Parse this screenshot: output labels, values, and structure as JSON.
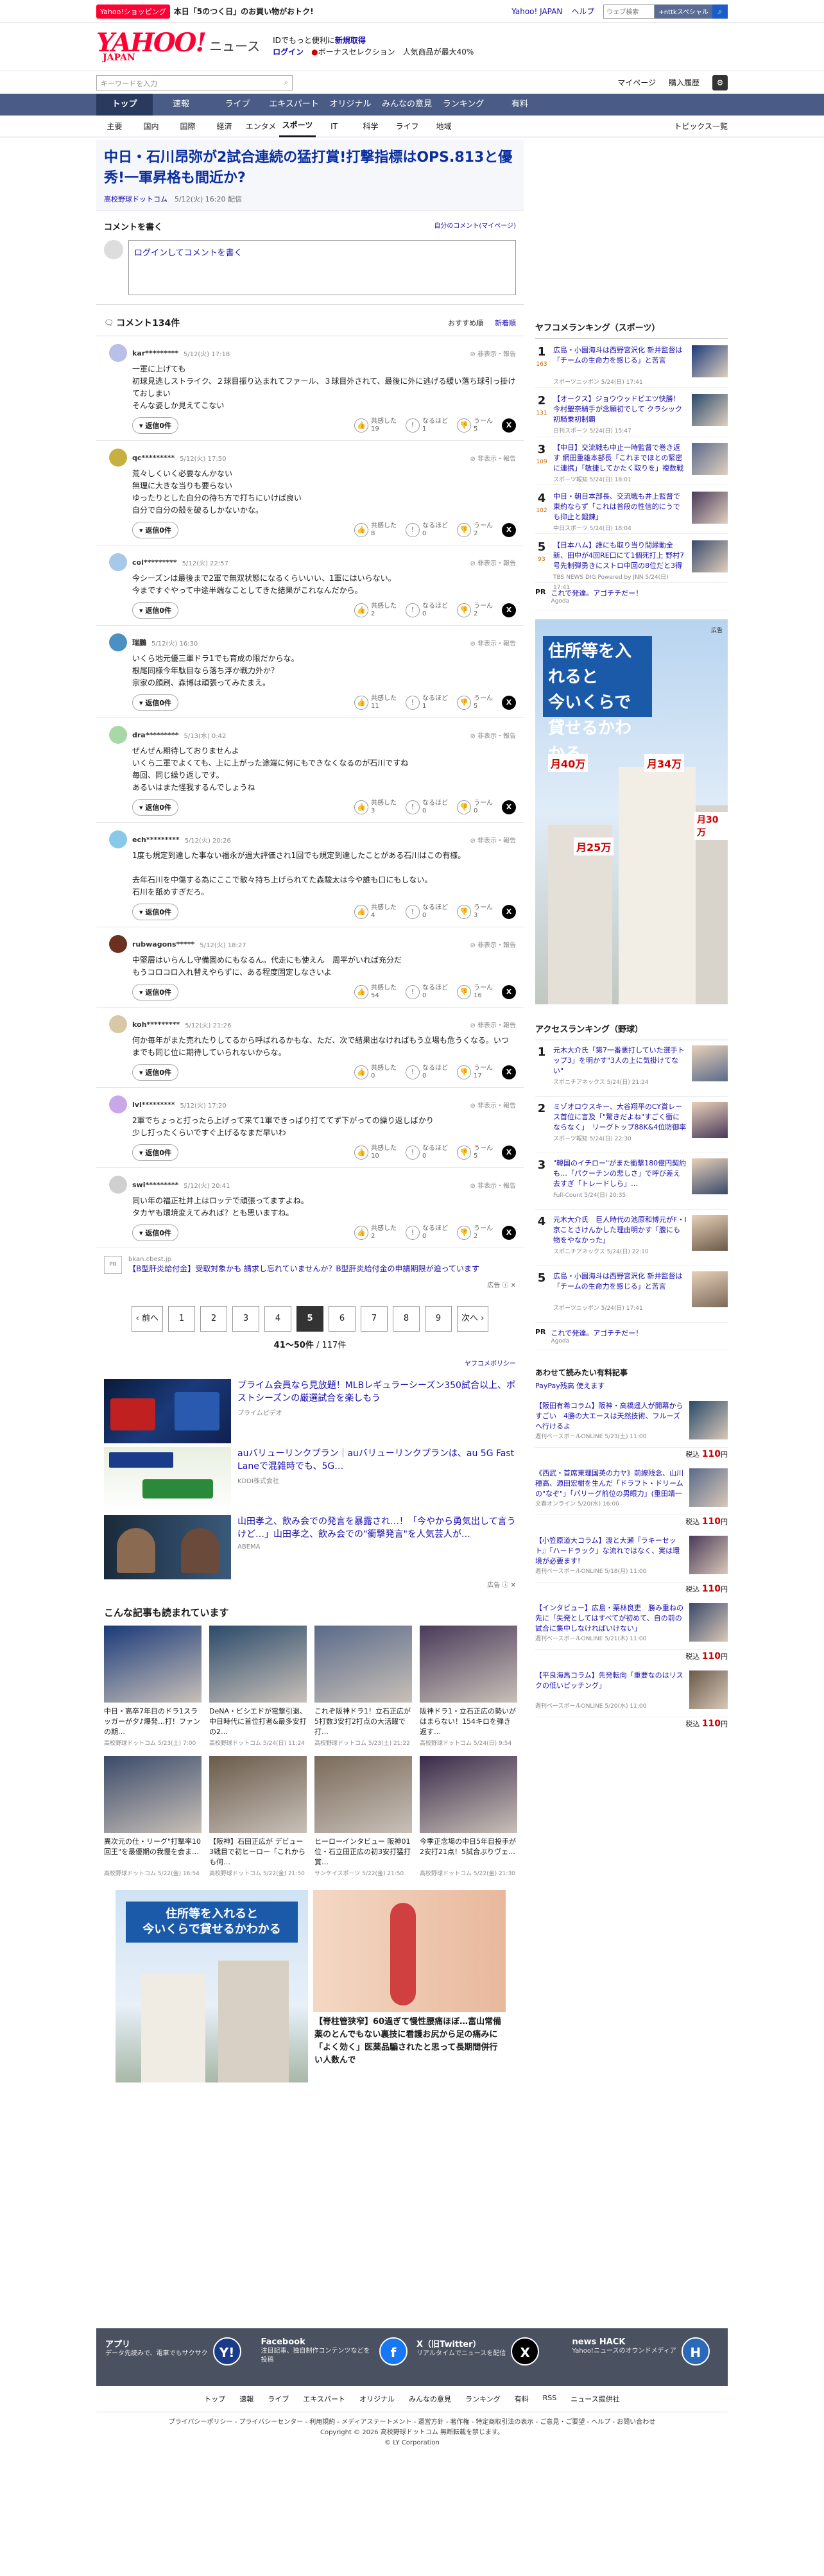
{
  "topbar": {
    "shop_badge": "Yahoo!ショッピング",
    "promo": "本日「5のつく日」のお買い物がおトク!",
    "links": [
      "Yahoo! JAPAN",
      "ヘルプ"
    ],
    "search_placeholder": "ウェブ検索",
    "search_btn": "+nttkスペシャル"
  },
  "brand": {
    "logo": "YAHOO!",
    "logo_sub": "JAPAN",
    "news": "ニュース",
    "line1": "IDでもっと便利に",
    "line1_link": "新規取得",
    "login": "ログイン",
    "bonus": "ボーナスセレクション",
    "bonus2": "人気商品が最大40%"
  },
  "search": {
    "placeholder": "キーワードを入力",
    "mypage": "マイページ",
    "purchased": "購入履歴"
  },
  "gnav": [
    "トップ",
    "速報",
    "ライブ",
    "エキスパート",
    "オリジナル",
    "みんなの意見",
    "ランキング",
    "有料"
  ],
  "snav": [
    "主要",
    "国内",
    "国際",
    "経済",
    "エンタメ",
    "スポーツ",
    "IT",
    "科学",
    "ライフ",
    "地域"
  ],
  "snav_topics": "トピックス一覧",
  "article": {
    "title": "中日・石川昂弥が2試合連続の猛打賞!打撃指標はOPS.813と優秀!一軍昇格も間近か?",
    "source": "高校野球ドットコム",
    "date": "5/12(火) 16:20 配信"
  },
  "commentbox": {
    "title": "コメントを書く",
    "mypage": "自分のコメント(マイページ)",
    "login": "ログイン",
    "placeholder": "してコメントを書く"
  },
  "comments_head": {
    "title": "コメント134件",
    "sort_rec": "おすすめ順",
    "sort_new": "新着順"
  },
  "labels": {
    "reply": "返信0件",
    "report": "非表示・報告",
    "r1": "共感した",
    "r2": "なるほど",
    "r3": "うーん"
  },
  "comments": [
    {
      "user": "kar*********",
      "time": "5/12(火) 17:18",
      "body": "一軍に上げても\n初球見逃しストライク、２球目振り込まれてファール、３球目外されて、最後に外に逃げる緩い落ち球引っ掛けておしまい\nそんな姿しか見えてこない",
      "r1": "19",
      "r2": "1",
      "r3": "5",
      "color": "#b8c0e8"
    },
    {
      "user": "qc*********",
      "time": "5/12(火) 17:50",
      "body": "荒々しくいく必要なんかない\n無理に大きな当りも要らない\nゆったりとした自分の待ち方で打ちにいけば良い\n自分で自分の殻を破るしかないかな。",
      "r1": "8",
      "r2": "0",
      "r3": "2",
      "color": "#c8b040"
    },
    {
      "user": "col*********",
      "time": "5/12(火) 22:57",
      "body": "今シーズンは最後まで2軍で無双状態になるくらいいい、1軍にはいらない。\n今まですぐやって中途半端なことしてきた結果がこれなんだから。",
      "r1": "2",
      "r2": "0",
      "r3": "2",
      "color": "#a8c8e8"
    },
    {
      "user": "瑞鵬",
      "time": "5/12(火) 16:30",
      "body": "いくら地元優三軍ドラ1でも育成の限だからな。\n根尾同様今年駄目なら落ち浮か戦力外か？\n宗家の顔刷、森博は頑張ってみたまえ。",
      "r1": "11",
      "r2": "1",
      "r3": "5",
      "color": "#4a90c0"
    },
    {
      "user": "dra*********",
      "time": "5/13(水) 0:42",
      "body": "ぜんぜん期待しておりませんよ\nいくら二軍でよくても、上に上がった途端に何にもできなくなるのが石川ですね\n毎回、同じ繰り返しです。\nあるいはまた怪我するんでしょうね",
      "r1": "3",
      "r2": "0",
      "r3": "0",
      "color": "#a8d8a8"
    },
    {
      "user": "ech*********",
      "time": "5/12(火) 20:26",
      "body": "1度も規定到達した事ない福永が過大評価され1回でも規定到達したことがある石川はこの有様。\n\n去年石川を中傷する為にここで散々持ち上げられてた森駿太は今や誰も口にもしない。\n石川を舐めすぎだろ。",
      "r1": "4",
      "r2": "0",
      "r3": "3",
      "color": "#88c8e8"
    },
    {
      "user": "rubwagons*****",
      "time": "5/12(火) 18:27",
      "body": "中堅層はいらんし守備固めにもなるん。代走にも使えん　周平がいれば充分だ\nもうコロコロ入れ替えやらずに、ある程度固定しなさいよ",
      "r1": "54",
      "r2": "0",
      "r3": "16",
      "color": "#6a3020"
    },
    {
      "user": "koh*********",
      "time": "5/12(火) 21:26",
      "body": "何か毎年がまた売れたりしてるから呼ばれるかもな、ただ、次で結果出なければもう立場も危うくなる。いつまでも同じ位に期待していられないからな。",
      "r1": "0",
      "r2": "0",
      "r3": "17",
      "color": "#d8c8a8"
    },
    {
      "user": "lvl*********",
      "time": "5/12(火) 17:20",
      "body": "2軍でちょっと打ったら上げって来て1軍できっぱり打ててず下がっての繰り返しばかり\n少し打ったくらいですぐ上げるなまだ早いわ",
      "r1": "10",
      "r2": "0",
      "r3": "5",
      "color": "#c8a8e8"
    },
    {
      "user": "swi*********",
      "time": "5/12(火) 20:41",
      "body": "同い年の福正社井上はロッテで頑張ってますよね。\nタカヤも環境変えてみれば？とも思いますね。",
      "r1": "2",
      "r2": "0",
      "r3": "2",
      "color": "#d0d0d0"
    }
  ],
  "ad1": {
    "icon": "PR",
    "domain": "bkan.cbest.jp",
    "text": "【B型肝炎給付金】受取対象かも 請求し忘れていませんか？B型肝炎給付金の申請期限が迫っています",
    "mark": "広告"
  },
  "pager": {
    "prev": "前へ",
    "next": "次へ",
    "pages": [
      "1",
      "2",
      "3",
      "4",
      "5",
      "6",
      "7",
      "8",
      "9"
    ],
    "current": "5",
    "count": "41〜50件",
    "total": "/ 117件",
    "policy": "ヤフコメポリシー"
  },
  "ads": [
    {
      "title": "プライム会員なら見放題！MLBレギュラーシーズン350試合以上、ポストシーズンの厳選試合を楽しもう",
      "src": "プライムビデオ"
    },
    {
      "title": "auバリューリンクプラン｜auバリューリンクプランは、au 5G Fast Laneで混雑時でも、5G…",
      "src": "KDDI株式会社"
    },
    {
      "title": "山田孝之、飲み会での発言を暴露され…！「今やから勇気出して言うけど…」山田孝之、飲み会での\"衝撃発言\"を人気芸人が…",
      "src": "ABEMA"
    }
  ],
  "ads_mark": "広告",
  "recommend": {
    "title": "こんな記事も読まれています",
    "items": [
      {
        "t": "中日・高卒7年目のドラ1スラッガーが夕♪爆発…打！ファンの期…",
        "s": "高校野球ドットコム 5/23(土) 7:00"
      },
      {
        "t": "DeNA・ビシエドが電撃引退、中日時代に首位打者&最多安打の2…",
        "s": "高校野球ドットコム 5/24(日) 11:24"
      },
      {
        "t": "これぞ阪神ドラ1！立石正広が5打数3安打2打点の大活躍で打…",
        "s": "高校野球ドットコム 5/23(土) 21:22"
      },
      {
        "t": "阪神ドラ1・立石正広の勢いがはまらない！154キロを弾き返す…",
        "s": "高校野球ドットコム 5/24(日) 9:54"
      },
      {
        "t": "異次元の仕・リーグ\"打撃率10回王\"を最優期の我慢を会ま…",
        "s": "高校野球ドットコム 5/22(金) 16:54"
      },
      {
        "t": "【阪神】石田正広が デビュー3戦目で初ヒーロー「これからも何…",
        "s": "高校野球ドットコム 5/22(金) 21:50"
      },
      {
        "t": "ヒーローインタビュー 阪神01位・石立田正広の初3安打猛打賞…",
        "s": "サンケイスポーツ 5/22(金) 21:50"
      },
      {
        "t": "今季正念場の中日5年目投手が2安打21点！5試合ぶりヴェ…",
        "s": "高校野球ドットコム 5/22(金) 21:30"
      }
    ]
  },
  "bigad": {
    "line1": "住所等を入れると",
    "line2": "今いくらで貸せるかわかる",
    "caption": "【脊柱管狭窄】60過ぎて慢性腰痛ほぼ…富山常備薬のとんでもない裏技に看護お尻から足の痛みに「よく効く」医薬品騙されたと思って長期間併行い人数んで"
  },
  "ranking": {
    "title": "ヤフコメランキング（スポーツ）",
    "items": [
      {
        "n": "1",
        "c": "163",
        "t": "広島・小園海斗は西野宮沢化 新井監督は「チームの生命力を感じる」と苦言",
        "s": "スポーツニッポン 5/24(日) 17:41"
      },
      {
        "n": "2",
        "c": "131",
        "t": "【オークス】ジョウウッドピエツ快勝！今村聖奈騎手が念願初でして\nクラシック初騎乗初制覇",
        "s": "日刊スポーツ 5/24(日) 15:47"
      },
      {
        "n": "3",
        "c": "109",
        "t": "【中日】交流戦も中止一時監督で巻き返す 網田重雄本部長「これまでほとの緊密に連携」「敏捷してかたく取りを」複数戦目",
        "s": "スポーツ報知 5/24(日) 18:01"
      },
      {
        "n": "4",
        "c": "102",
        "t": "中日・朝日本部長、交流戦も井上監督で東約ならず「これは普段の性信的にうでも抑止と鍛錬」",
        "s": "中日スポーツ 5/24(日) 18:04"
      },
      {
        "n": "5",
        "c": "93",
        "t": "【日本ハム】誰にも取り当り間縁動全新、田中が4回RE口にて1個死打上 野村7号先制弾勇きにストロ中回の8位だと3得も力帯たく 北山ワースト40%失点0M",
        "s": "TBS NEWS DIG Powered by JNN 5/24(日) 17:41"
      }
    ]
  },
  "pr1": {
    "label": "PR",
    "title": "これで発達。アゴチチだー！",
    "src": "Agoda"
  },
  "sidead": {
    "line1": "住所等を入れると",
    "line2": "今いくらで",
    "line3": "貸せるかわかる",
    "p1": "月40万",
    "p2": "月34万",
    "p3": "月25万",
    "p4": "月30万",
    "mark": "広告"
  },
  "access": {
    "title": "アクセスランキング（野球）",
    "items": [
      {
        "n": "1",
        "t": "元木大介氏「第7一番悪打していた選手トップ3」を明かす\"3人の上に気掛けてない\"",
        "s": "スポニチアネックス 5/24(日) 21:24"
      },
      {
        "n": "2",
        "t": "ミゾオロウスキー、大谷翔平のCY賞レース首位に言及「\"驚きだよね\"すごく衝にならなく」　リーグトップ88K&4位防御率1.89",
        "s": "スポーツ報知 5/24(日) 22:30"
      },
      {
        "n": "3",
        "t": "\"韓国のイチロー\"がまた衝撃180億円契約も…「パクーチンの悲しさ」で呼び差え去すぎ「トレードしら」…",
        "s": "Full-Count 5/24(日) 20:35"
      },
      {
        "n": "4",
        "t": "元木大介氏　巨人時代の池原和博元がF・I 京ことさけんかした理由明かす「腹にも物をやなかった」",
        "s": "スポニチアネックス 5/24(日) 22:10"
      },
      {
        "n": "5",
        "t": "広島・小園海斗は西野宮沢化 新井監督は「チームの生命力を感じる」と苦言",
        "s": "スポーツニッポン 5/24(日) 17:41"
      }
    ]
  },
  "pr2": {
    "label": "PR",
    "title": "これで発達。アゴチチだー！",
    "src": "Agoda"
  },
  "shop": {
    "title": "あわせて読みたい有料記事",
    "sub": "PayPay残高 使えます",
    "price_label": "税込",
    "items": [
      {
        "t": "【阪田有希コラム】阪神・高橋遥人が開幕からすごい　4勝の大エースは天然技術、フルーズへ行けるよ",
        "s": "週刊ベースボールONLINE 5/23(土) 11:00",
        "p": "110"
      },
      {
        "t": "《西武・首席東理国英の力ヤ》前線残念、山川穂高、源田宏樹を生んだ「ドラフト・ドリームの\"なぞ\"」「パリーグ前位の男眼力」(重田靖一野球の言葉学【氏出し文定】",
        "s": "文春オンライン 5/20(水) 16:00",
        "p": "110"
      },
      {
        "t": "【小笠原道大コラム】渡と大瀬『ラキーセット』「ハードラック」な流れではなく、実は環境が必要ます!",
        "s": "週刊ベースボールONLINE 5/18(月) 11:00",
        "p": "110"
      },
      {
        "t": "【インタビュー】広島・栗林良吏　勝み重ねの先に「失発としてはすべてが初めて、自の前の試合に集中しなければいけない」",
        "s": "週刊ベースボールONLINE 5/21(木) 11:00",
        "p": "110"
      },
      {
        "t": "【平良海馬コラム】先発転向「重要なのはリスクの低いピッチング」",
        "s": "週刊ベースボールONLINE 5/20(水) 11:00",
        "p": "110"
      }
    ]
  },
  "footer": {
    "cols": [
      {
        "t": "アプリ",
        "d": "データ先読みで、電車でもサクサク",
        "icon": "Y!"
      },
      {
        "t": "Facebook",
        "d": "注目記事、独自制作コンテンツなどを投稿",
        "icon": "f"
      },
      {
        "t": "X（旧Twitter）",
        "d": "リアルタイムでニュースを配信",
        "icon": "X"
      },
      {
        "t": "news HACK",
        "d": "Yahoo!ニュースのオウンドメディア",
        "icon": "H"
      }
    ],
    "links": [
      "トップ",
      "速報",
      "ライブ",
      "エキスパート",
      "オリジナル",
      "みんなの意見",
      "ランキング",
      "有料",
      "RSS",
      "ニュース提供社"
    ],
    "policy": "プライバシーポリシー - プライバシーセンター - 利用規約 - メディアステートメント - 運営方針 - 著作権 - 特定商取引法の表示 - ご意見・ご要望 - ヘルプ - お問い合わせ",
    "copy1": "Copyright © 2026 高校野球ドットコム 無断転載を禁じます。",
    "copy2": "© LY Corporation"
  }
}
